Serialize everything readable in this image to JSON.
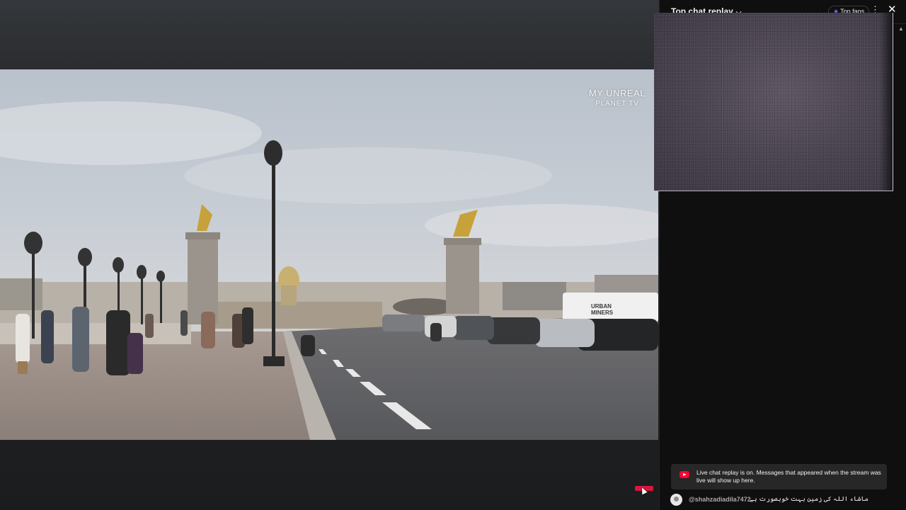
{
  "video": {
    "watermark_line1": "MY UNREAL",
    "watermark_line2": "PLANET TV",
    "van_text": "URBAN MINERS"
  },
  "chat": {
    "title": "Top chat replay",
    "chevron_icon": "chevron-down-icon",
    "top_fans_label": "Top fans",
    "more_icon": "more-vert-icon",
    "close_icon": "close-icon",
    "notice_text": "Live chat replay is on. Messages that appeared when the stream was live will show up here.",
    "messages": [
      {
        "author": "@shahzadiadila7472",
        "text": "ماشاء اللہ کی زمین بہت خوبصورت ہے"
      }
    ]
  },
  "colors": {
    "chat_bg": "#0f0f0f",
    "notice_bg": "#272727",
    "youtube_red": "#ff0033",
    "top_fans_star": "#7b61ff"
  }
}
